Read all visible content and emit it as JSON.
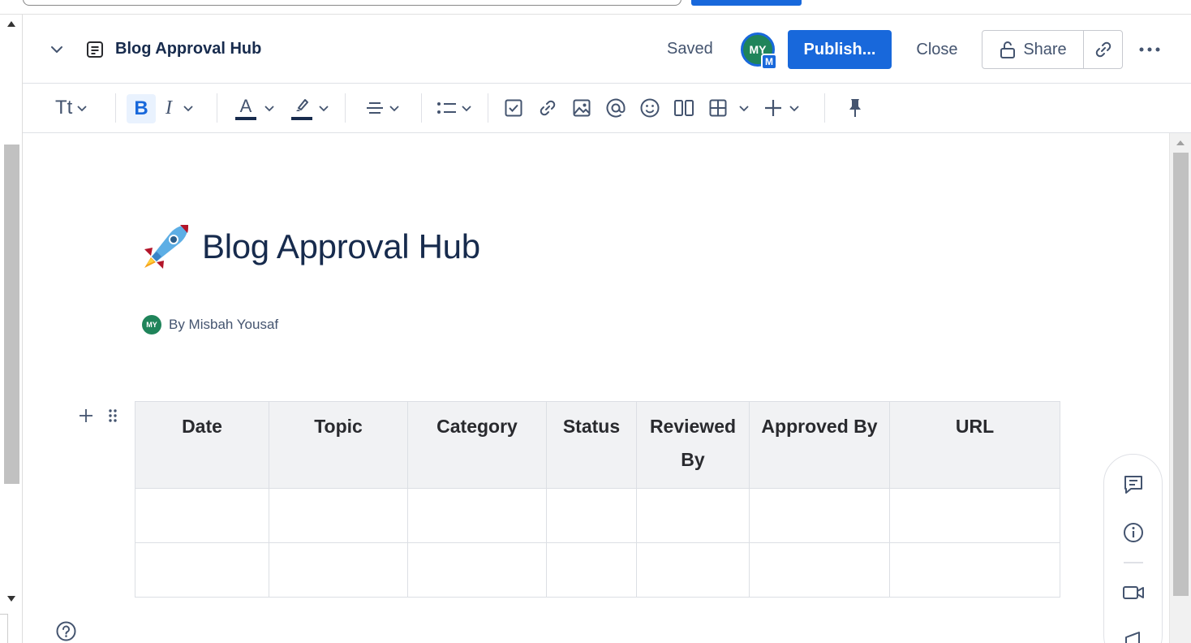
{
  "header": {
    "page_title": "Blog Approval Hub",
    "save_status": "Saved",
    "avatar_initials": "MY",
    "avatar_badge": "M",
    "publish_label": "Publish...",
    "close_label": "Close",
    "share_label": "Share"
  },
  "toolbar": {
    "text_style_label": "Tt",
    "bold_label": "B",
    "italic_label": "I",
    "text_color_label": "A",
    "items": [
      "text-style",
      "bold",
      "italic",
      "text-color",
      "highlight",
      "alignment",
      "list",
      "task",
      "link",
      "image",
      "mention",
      "emoji",
      "layouts",
      "table",
      "insert",
      "pin"
    ]
  },
  "document": {
    "title": "Blog Approval Hub",
    "emoji": "rocket",
    "byline_initials": "MY",
    "byline": "By Misbah Yousaf"
  },
  "table": {
    "headers": [
      "Date",
      "Topic",
      "Category",
      "Status",
      "Reviewed By",
      "Approved By",
      "URL"
    ],
    "rows": [
      [
        "",
        "",
        "",
        "",
        "",
        "",
        ""
      ],
      [
        "",
        "",
        "",
        "",
        "",
        "",
        ""
      ]
    ]
  },
  "side_panel": {
    "items": [
      "comment-icon",
      "info-icon",
      "video-icon",
      "megaphone-icon"
    ]
  },
  "colors": {
    "primary": "#1868db",
    "avatar": "#1f845a",
    "header_cell_bg": "#f1f2f4",
    "text": "#172b4d"
  }
}
